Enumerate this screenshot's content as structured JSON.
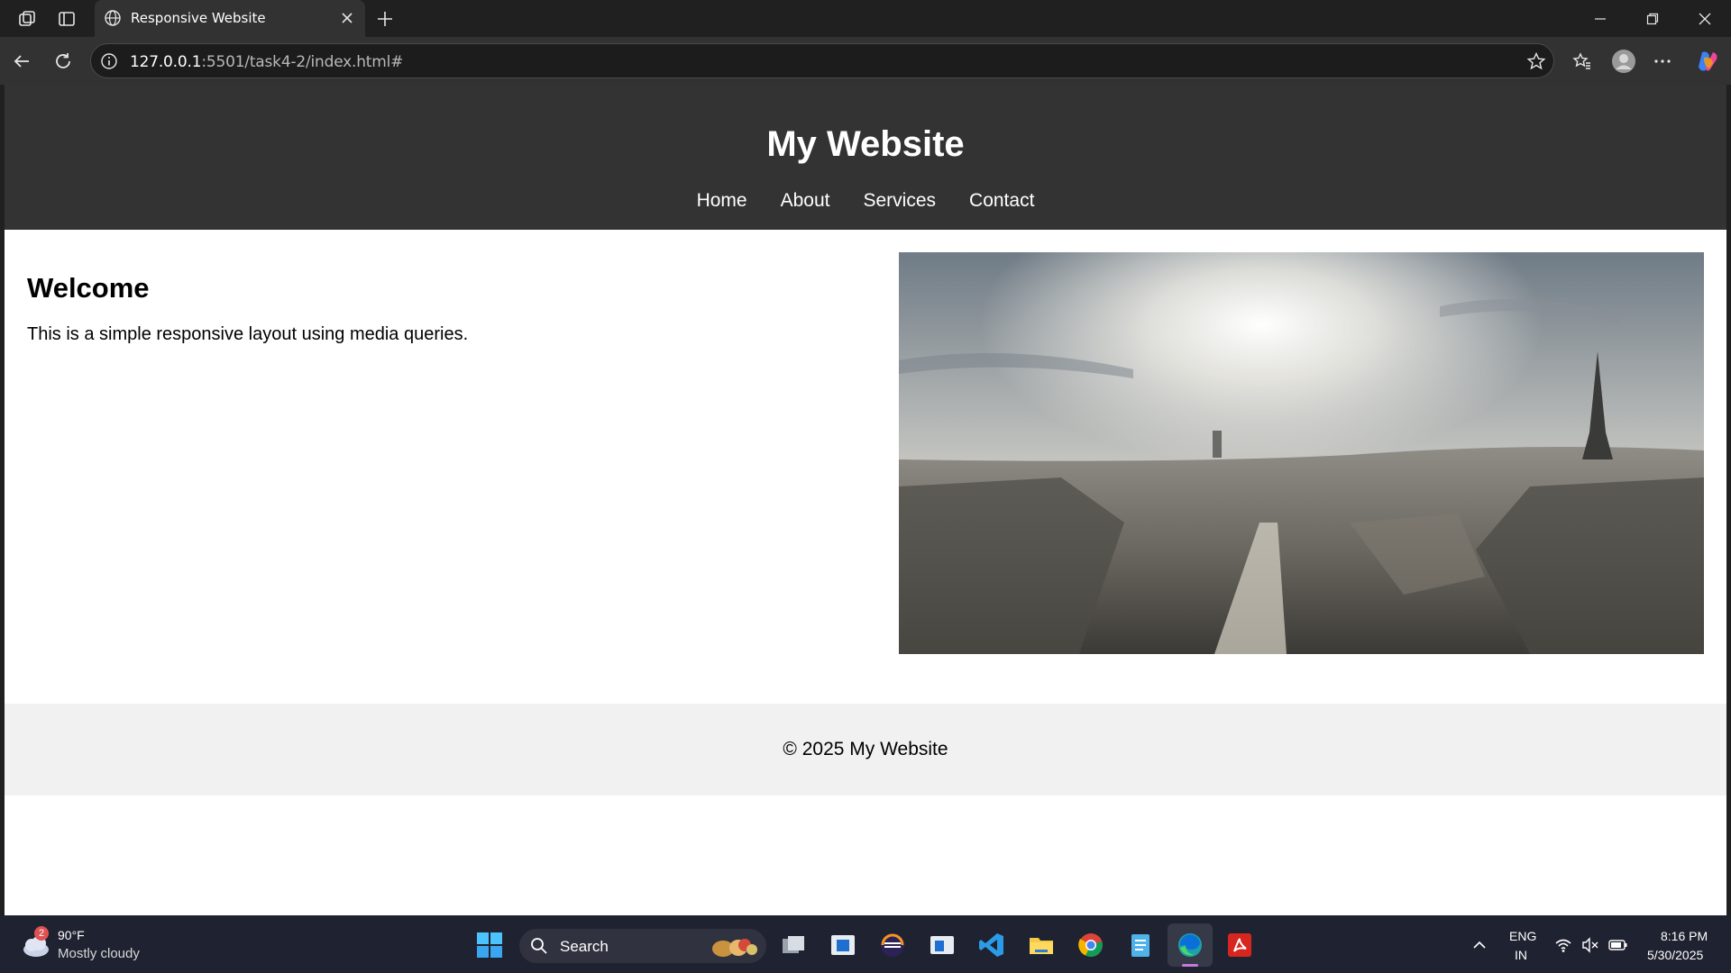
{
  "browser": {
    "tab_title": "Responsive Website",
    "url_host": "127.0.0.1",
    "url_rest": ":5501/task4-2/index.html#"
  },
  "site": {
    "title": "My Website",
    "nav": [
      "Home",
      "About",
      "Services",
      "Contact"
    ],
    "heading": "Welcome",
    "intro": "This is a simple responsive layout using media queries.",
    "footer": "© 2025 My Website"
  },
  "taskbar": {
    "weather_badge": "2",
    "temperature": "90°F",
    "condition": "Mostly cloudy",
    "search_label": "Search",
    "lang_primary": "ENG",
    "lang_secondary": "IN",
    "time": "8:16 PM",
    "date": "5/30/2025"
  },
  "colors": {
    "header_bg": "#333333",
    "footer_bg": "#f1f1f1",
    "taskbar_bg": "#1f2230"
  }
}
